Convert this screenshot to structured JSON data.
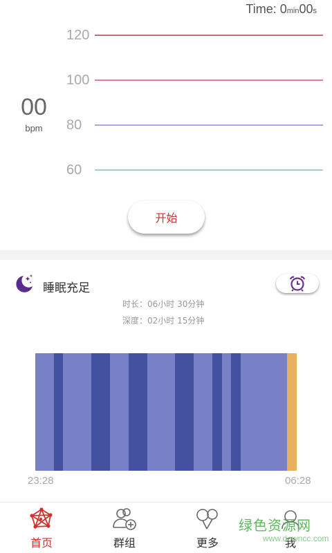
{
  "heart_rate": {
    "timer": {
      "prefix": "Time: ",
      "minutes": "0",
      "min_unit": "min",
      "seconds": "00",
      "sec_unit": "s"
    },
    "bpm_value": "00",
    "bpm_unit": "bpm",
    "ticks": [
      {
        "label": "120",
        "color": "#b9726b"
      },
      {
        "label": "100",
        "color": "#e07c9e"
      },
      {
        "label": "80",
        "color": "#a8a6e6"
      },
      {
        "label": "60",
        "color": "#a8d0c2"
      }
    ],
    "start_label": "开始"
  },
  "sleep": {
    "title": "睡眠充足",
    "duration": "时长：06小时 30分钟",
    "deep": "深度：02小时 15分钟",
    "start_time": "23:28",
    "end_time": "06:28",
    "colors": {
      "light": "#7880c8",
      "deep": "#4450a0",
      "awake": "#e8b060"
    }
  },
  "nav": {
    "items": [
      {
        "label": "首页",
        "icon": "home-network-icon"
      },
      {
        "label": "群组",
        "icon": "group-add-icon"
      },
      {
        "label": "更多",
        "icon": "balloons-icon"
      },
      {
        "label": "我",
        "icon": "profile-icon"
      }
    ],
    "active_color": "#d0312d"
  },
  "watermark": {
    "main": "绿色资源网",
    "sub": "www.downcc.com"
  }
}
